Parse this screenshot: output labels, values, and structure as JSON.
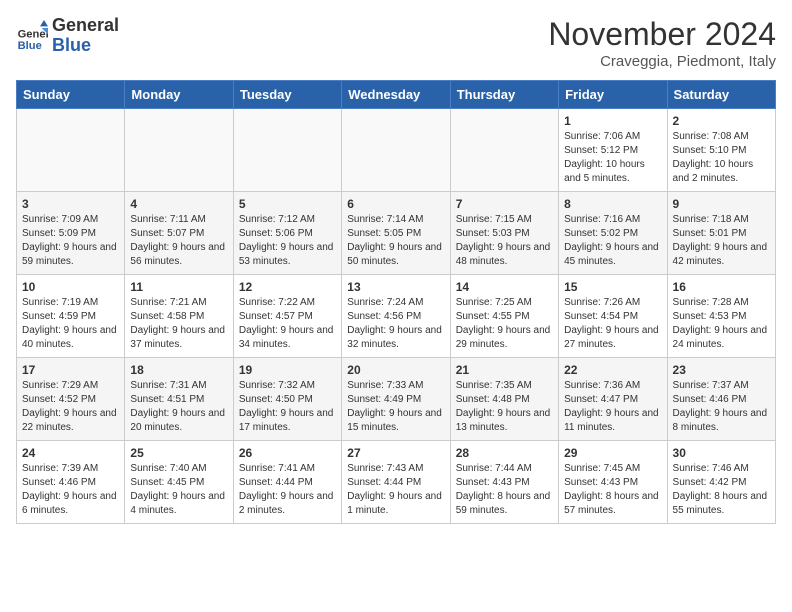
{
  "logo": {
    "general": "General",
    "blue": "Blue"
  },
  "title": "November 2024",
  "location": "Craveggia, Piedmont, Italy",
  "days_header": [
    "Sunday",
    "Monday",
    "Tuesday",
    "Wednesday",
    "Thursday",
    "Friday",
    "Saturday"
  ],
  "weeks": [
    [
      {
        "day": "",
        "info": ""
      },
      {
        "day": "",
        "info": ""
      },
      {
        "day": "",
        "info": ""
      },
      {
        "day": "",
        "info": ""
      },
      {
        "day": "",
        "info": ""
      },
      {
        "day": "1",
        "info": "Sunrise: 7:06 AM\nSunset: 5:12 PM\nDaylight: 10 hours and 5 minutes."
      },
      {
        "day": "2",
        "info": "Sunrise: 7:08 AM\nSunset: 5:10 PM\nDaylight: 10 hours and 2 minutes."
      }
    ],
    [
      {
        "day": "3",
        "info": "Sunrise: 7:09 AM\nSunset: 5:09 PM\nDaylight: 9 hours and 59 minutes."
      },
      {
        "day": "4",
        "info": "Sunrise: 7:11 AM\nSunset: 5:07 PM\nDaylight: 9 hours and 56 minutes."
      },
      {
        "day": "5",
        "info": "Sunrise: 7:12 AM\nSunset: 5:06 PM\nDaylight: 9 hours and 53 minutes."
      },
      {
        "day": "6",
        "info": "Sunrise: 7:14 AM\nSunset: 5:05 PM\nDaylight: 9 hours and 50 minutes."
      },
      {
        "day": "7",
        "info": "Sunrise: 7:15 AM\nSunset: 5:03 PM\nDaylight: 9 hours and 48 minutes."
      },
      {
        "day": "8",
        "info": "Sunrise: 7:16 AM\nSunset: 5:02 PM\nDaylight: 9 hours and 45 minutes."
      },
      {
        "day": "9",
        "info": "Sunrise: 7:18 AM\nSunset: 5:01 PM\nDaylight: 9 hours and 42 minutes."
      }
    ],
    [
      {
        "day": "10",
        "info": "Sunrise: 7:19 AM\nSunset: 4:59 PM\nDaylight: 9 hours and 40 minutes."
      },
      {
        "day": "11",
        "info": "Sunrise: 7:21 AM\nSunset: 4:58 PM\nDaylight: 9 hours and 37 minutes."
      },
      {
        "day": "12",
        "info": "Sunrise: 7:22 AM\nSunset: 4:57 PM\nDaylight: 9 hours and 34 minutes."
      },
      {
        "day": "13",
        "info": "Sunrise: 7:24 AM\nSunset: 4:56 PM\nDaylight: 9 hours and 32 minutes."
      },
      {
        "day": "14",
        "info": "Sunrise: 7:25 AM\nSunset: 4:55 PM\nDaylight: 9 hours and 29 minutes."
      },
      {
        "day": "15",
        "info": "Sunrise: 7:26 AM\nSunset: 4:54 PM\nDaylight: 9 hours and 27 minutes."
      },
      {
        "day": "16",
        "info": "Sunrise: 7:28 AM\nSunset: 4:53 PM\nDaylight: 9 hours and 24 minutes."
      }
    ],
    [
      {
        "day": "17",
        "info": "Sunrise: 7:29 AM\nSunset: 4:52 PM\nDaylight: 9 hours and 22 minutes."
      },
      {
        "day": "18",
        "info": "Sunrise: 7:31 AM\nSunset: 4:51 PM\nDaylight: 9 hours and 20 minutes."
      },
      {
        "day": "19",
        "info": "Sunrise: 7:32 AM\nSunset: 4:50 PM\nDaylight: 9 hours and 17 minutes."
      },
      {
        "day": "20",
        "info": "Sunrise: 7:33 AM\nSunset: 4:49 PM\nDaylight: 9 hours and 15 minutes."
      },
      {
        "day": "21",
        "info": "Sunrise: 7:35 AM\nSunset: 4:48 PM\nDaylight: 9 hours and 13 minutes."
      },
      {
        "day": "22",
        "info": "Sunrise: 7:36 AM\nSunset: 4:47 PM\nDaylight: 9 hours and 11 minutes."
      },
      {
        "day": "23",
        "info": "Sunrise: 7:37 AM\nSunset: 4:46 PM\nDaylight: 9 hours and 8 minutes."
      }
    ],
    [
      {
        "day": "24",
        "info": "Sunrise: 7:39 AM\nSunset: 4:46 PM\nDaylight: 9 hours and 6 minutes."
      },
      {
        "day": "25",
        "info": "Sunrise: 7:40 AM\nSunset: 4:45 PM\nDaylight: 9 hours and 4 minutes."
      },
      {
        "day": "26",
        "info": "Sunrise: 7:41 AM\nSunset: 4:44 PM\nDaylight: 9 hours and 2 minutes."
      },
      {
        "day": "27",
        "info": "Sunrise: 7:43 AM\nSunset: 4:44 PM\nDaylight: 9 hours and 1 minute."
      },
      {
        "day": "28",
        "info": "Sunrise: 7:44 AM\nSunset: 4:43 PM\nDaylight: 8 hours and 59 minutes."
      },
      {
        "day": "29",
        "info": "Sunrise: 7:45 AM\nSunset: 4:43 PM\nDaylight: 8 hours and 57 minutes."
      },
      {
        "day": "30",
        "info": "Sunrise: 7:46 AM\nSunset: 4:42 PM\nDaylight: 8 hours and 55 minutes."
      }
    ]
  ]
}
